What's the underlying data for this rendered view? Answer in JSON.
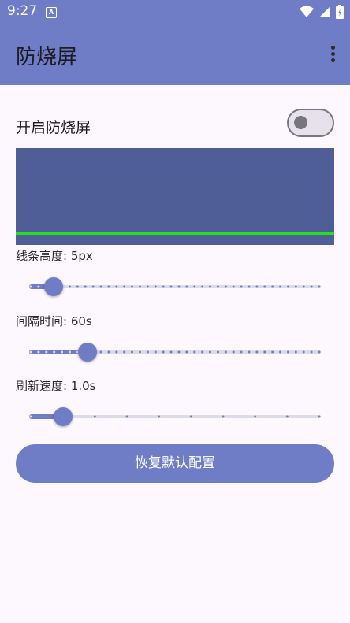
{
  "status_bar": {
    "time": "9:27",
    "notification_icon": "A"
  },
  "app_bar": {
    "title": "防烧屏",
    "menu_icon": "more-vert-icon"
  },
  "toggle": {
    "label": "开启防烧屏",
    "on": false
  },
  "preview": {
    "background": "#4f5e96",
    "line_color": "#21e121"
  },
  "sliders": [
    {
      "label": "线条高度: 5px",
      "value": 0.085,
      "ticks": 38,
      "dense": true
    },
    {
      "label": "间隔时间: 60s",
      "value": 0.2,
      "ticks": 38,
      "dense": true
    },
    {
      "label": "刷新速度: 1.0s",
      "value": 0.115,
      "ticks": 10,
      "dense": false
    }
  ],
  "reset_button": {
    "label": "恢复默认配置"
  },
  "colors": {
    "accent": "#6f7dc6",
    "background": "#fcf8fd"
  }
}
